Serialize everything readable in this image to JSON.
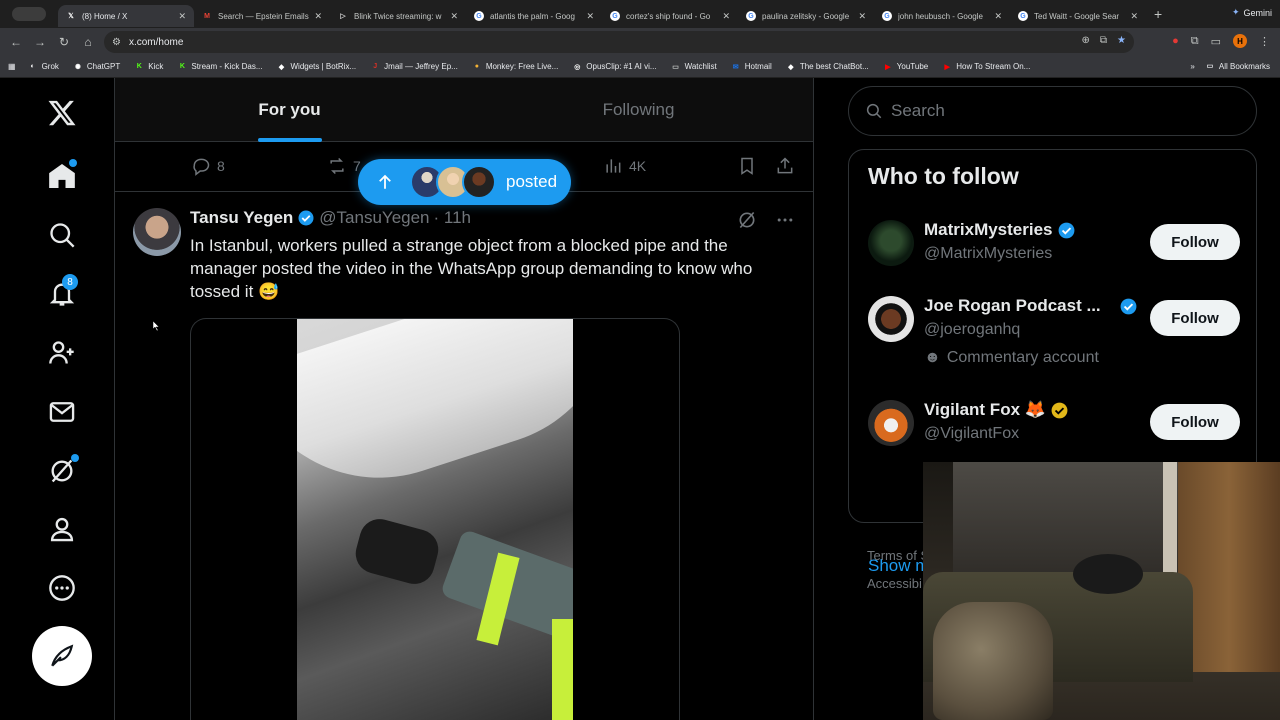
{
  "browser": {
    "tabs": [
      {
        "title": "(8) Home / X",
        "icon": "x-logo",
        "active": true
      },
      {
        "title": "Search — Epstein Emails",
        "icon": "gmail"
      },
      {
        "title": "Blink Twice streaming: w",
        "icon": "play"
      },
      {
        "title": "atlantis the palm - Goog",
        "icon": "google"
      },
      {
        "title": "cortez's ship found - Go",
        "icon": "google"
      },
      {
        "title": "paulina zelitsky - Google",
        "icon": "google"
      },
      {
        "title": "john heubusch - Google",
        "icon": "google"
      },
      {
        "title": "Ted Waitt - Google Sear",
        "icon": "google"
      }
    ],
    "gemini_label": "Gemini",
    "url": "x.com/home",
    "bookmarks": [
      {
        "label": "Grok",
        "color": "#ffffff"
      },
      {
        "label": "ChatGPT",
        "color": "#ffffff"
      },
      {
        "label": "Kick",
        "color": "#53fc18"
      },
      {
        "label": "Stream - Kick Das...",
        "color": "#53fc18"
      },
      {
        "label": "Widgets | BotRix...",
        "color": "#ffffff"
      },
      {
        "label": "Jmail — Jeffrey Ep...",
        "color": "#d93025"
      },
      {
        "label": "Monkey: Free Live...",
        "color": "#f2b134"
      },
      {
        "label": "OpusClip: #1 AI vi...",
        "color": "#ffffff"
      },
      {
        "label": "Watchlist",
        "color": "#c4c7c5"
      },
      {
        "label": "Hotmail",
        "color": "#1a73e8"
      },
      {
        "label": "The best ChatBot...",
        "color": "#ffffff"
      },
      {
        "label": "YouTube",
        "color": "#ff0000"
      },
      {
        "label": "How To Stream On...",
        "color": "#ff0000"
      }
    ],
    "all_bookmarks": "All Bookmarks",
    "profile_initial": "H"
  },
  "nav": {
    "notifications_count": "8"
  },
  "feed": {
    "tab_for_you": "For you",
    "tab_following": "Following",
    "prev_actions": {
      "replies": "8",
      "reposts": "7",
      "views": "4K"
    },
    "posted_pill": "posted"
  },
  "tweet": {
    "name": "Tansu Yegen",
    "handle": "@TansuYegen",
    "time": "· 11h",
    "text": "In Istanbul, workers pulled a strange object from a blocked pipe and the manager posted the video in the WhatsApp group demanding to know who tossed it 😅"
  },
  "sidebar": {
    "search_placeholder": "Search",
    "who_to_follow": "Who to follow",
    "accounts": [
      {
        "name": "MatrixMysteries",
        "handle": "@MatrixMysteries",
        "badge": "blue",
        "follow": "Follow"
      },
      {
        "name": "Joe Rogan Podcast ...",
        "handle": "@joeroganhq",
        "badge": "blue",
        "sub": "Commentary account",
        "follow": "Follow"
      },
      {
        "name": "Vigilant Fox 🦊",
        "handle": "@VigilantFox",
        "badge": "gold",
        "follow": "Follow"
      }
    ],
    "show_more": "Show m",
    "footer_terms": "Terms of S",
    "footer_access": "Accessibi"
  },
  "colors": {
    "accent": "#1d9bf0",
    "bg": "#000000",
    "muted": "#71767b"
  }
}
